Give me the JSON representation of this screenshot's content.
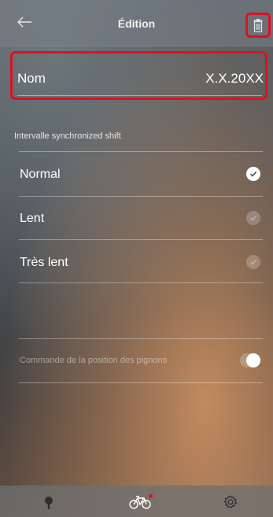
{
  "header": {
    "title": "Édition",
    "back_icon": "arrow-left-icon",
    "delete_icon": "trash-icon"
  },
  "name_field": {
    "label": "Nom",
    "value": "X.X.20XX"
  },
  "interval": {
    "section_title": "Intervalle synchronized shift",
    "options": [
      {
        "label": "Normal",
        "selected": true
      },
      {
        "label": "Lent",
        "selected": false
      },
      {
        "label": "Très lent",
        "selected": false
      }
    ]
  },
  "gear_position": {
    "label": "Commande de la position des pignons",
    "enabled": true
  },
  "tabbar": {
    "tabs": [
      {
        "icon": "pin-icon"
      },
      {
        "icon": "bicycle-icon",
        "badge": true,
        "active": true
      },
      {
        "icon": "gear-icon"
      }
    ]
  },
  "colors": {
    "highlight": "#e0101f",
    "badge": "#e0101f"
  }
}
